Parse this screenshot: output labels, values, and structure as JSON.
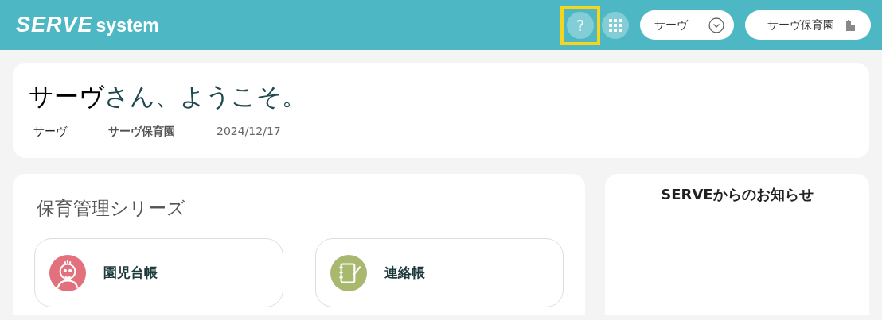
{
  "header": {
    "logo_main": "SERVE",
    "logo_sub": "system",
    "help_button": {
      "label": "?",
      "highlighted": true
    },
    "user_menu": {
      "label": "サーヴ"
    },
    "facility_button": {
      "label": "サーヴ保育園"
    }
  },
  "welcome": {
    "name": "サーヴ",
    "suffix": "さん、ようこそ。",
    "user": "サーヴ",
    "facility": "サーヴ保育園",
    "date": "2024/12/17"
  },
  "series": {
    "title": "保育管理シリーズ",
    "apps": [
      {
        "label": "園児台帳",
        "kind": "child",
        "color": "#e2717d"
      },
      {
        "label": "連絡帳",
        "kind": "notebook",
        "color": "#a9b86f"
      }
    ]
  },
  "news": {
    "title": "SERVEからのお知らせ"
  }
}
